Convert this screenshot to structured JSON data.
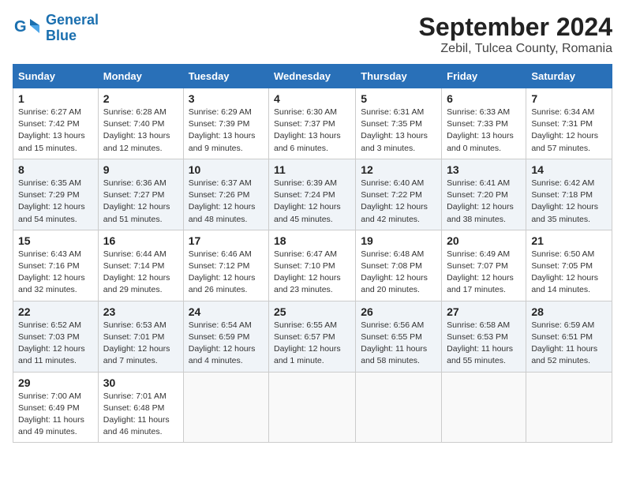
{
  "logo": {
    "line1": "General",
    "line2": "Blue"
  },
  "title": "September 2024",
  "location": "Zebil, Tulcea County, Romania",
  "days_of_week": [
    "Sunday",
    "Monday",
    "Tuesday",
    "Wednesday",
    "Thursday",
    "Friday",
    "Saturday"
  ],
  "weeks": [
    [
      {
        "num": "1",
        "info": "Sunrise: 6:27 AM\nSunset: 7:42 PM\nDaylight: 13 hours\nand 15 minutes."
      },
      {
        "num": "2",
        "info": "Sunrise: 6:28 AM\nSunset: 7:40 PM\nDaylight: 13 hours\nand 12 minutes."
      },
      {
        "num": "3",
        "info": "Sunrise: 6:29 AM\nSunset: 7:39 PM\nDaylight: 13 hours\nand 9 minutes."
      },
      {
        "num": "4",
        "info": "Sunrise: 6:30 AM\nSunset: 7:37 PM\nDaylight: 13 hours\nand 6 minutes."
      },
      {
        "num": "5",
        "info": "Sunrise: 6:31 AM\nSunset: 7:35 PM\nDaylight: 13 hours\nand 3 minutes."
      },
      {
        "num": "6",
        "info": "Sunrise: 6:33 AM\nSunset: 7:33 PM\nDaylight: 13 hours\nand 0 minutes."
      },
      {
        "num": "7",
        "info": "Sunrise: 6:34 AM\nSunset: 7:31 PM\nDaylight: 12 hours\nand 57 minutes."
      }
    ],
    [
      {
        "num": "8",
        "info": "Sunrise: 6:35 AM\nSunset: 7:29 PM\nDaylight: 12 hours\nand 54 minutes."
      },
      {
        "num": "9",
        "info": "Sunrise: 6:36 AM\nSunset: 7:27 PM\nDaylight: 12 hours\nand 51 minutes."
      },
      {
        "num": "10",
        "info": "Sunrise: 6:37 AM\nSunset: 7:26 PM\nDaylight: 12 hours\nand 48 minutes."
      },
      {
        "num": "11",
        "info": "Sunrise: 6:39 AM\nSunset: 7:24 PM\nDaylight: 12 hours\nand 45 minutes."
      },
      {
        "num": "12",
        "info": "Sunrise: 6:40 AM\nSunset: 7:22 PM\nDaylight: 12 hours\nand 42 minutes."
      },
      {
        "num": "13",
        "info": "Sunrise: 6:41 AM\nSunset: 7:20 PM\nDaylight: 12 hours\nand 38 minutes."
      },
      {
        "num": "14",
        "info": "Sunrise: 6:42 AM\nSunset: 7:18 PM\nDaylight: 12 hours\nand 35 minutes."
      }
    ],
    [
      {
        "num": "15",
        "info": "Sunrise: 6:43 AM\nSunset: 7:16 PM\nDaylight: 12 hours\nand 32 minutes."
      },
      {
        "num": "16",
        "info": "Sunrise: 6:44 AM\nSunset: 7:14 PM\nDaylight: 12 hours\nand 29 minutes."
      },
      {
        "num": "17",
        "info": "Sunrise: 6:46 AM\nSunset: 7:12 PM\nDaylight: 12 hours\nand 26 minutes."
      },
      {
        "num": "18",
        "info": "Sunrise: 6:47 AM\nSunset: 7:10 PM\nDaylight: 12 hours\nand 23 minutes."
      },
      {
        "num": "19",
        "info": "Sunrise: 6:48 AM\nSunset: 7:08 PM\nDaylight: 12 hours\nand 20 minutes."
      },
      {
        "num": "20",
        "info": "Sunrise: 6:49 AM\nSunset: 7:07 PM\nDaylight: 12 hours\nand 17 minutes."
      },
      {
        "num": "21",
        "info": "Sunrise: 6:50 AM\nSunset: 7:05 PM\nDaylight: 12 hours\nand 14 minutes."
      }
    ],
    [
      {
        "num": "22",
        "info": "Sunrise: 6:52 AM\nSunset: 7:03 PM\nDaylight: 12 hours\nand 11 minutes."
      },
      {
        "num": "23",
        "info": "Sunrise: 6:53 AM\nSunset: 7:01 PM\nDaylight: 12 hours\nand 7 minutes."
      },
      {
        "num": "24",
        "info": "Sunrise: 6:54 AM\nSunset: 6:59 PM\nDaylight: 12 hours\nand 4 minutes."
      },
      {
        "num": "25",
        "info": "Sunrise: 6:55 AM\nSunset: 6:57 PM\nDaylight: 12 hours\nand 1 minute."
      },
      {
        "num": "26",
        "info": "Sunrise: 6:56 AM\nSunset: 6:55 PM\nDaylight: 11 hours\nand 58 minutes."
      },
      {
        "num": "27",
        "info": "Sunrise: 6:58 AM\nSunset: 6:53 PM\nDaylight: 11 hours\nand 55 minutes."
      },
      {
        "num": "28",
        "info": "Sunrise: 6:59 AM\nSunset: 6:51 PM\nDaylight: 11 hours\nand 52 minutes."
      }
    ],
    [
      {
        "num": "29",
        "info": "Sunrise: 7:00 AM\nSunset: 6:49 PM\nDaylight: 11 hours\nand 49 minutes."
      },
      {
        "num": "30",
        "info": "Sunrise: 7:01 AM\nSunset: 6:48 PM\nDaylight: 11 hours\nand 46 minutes."
      },
      null,
      null,
      null,
      null,
      null
    ]
  ]
}
